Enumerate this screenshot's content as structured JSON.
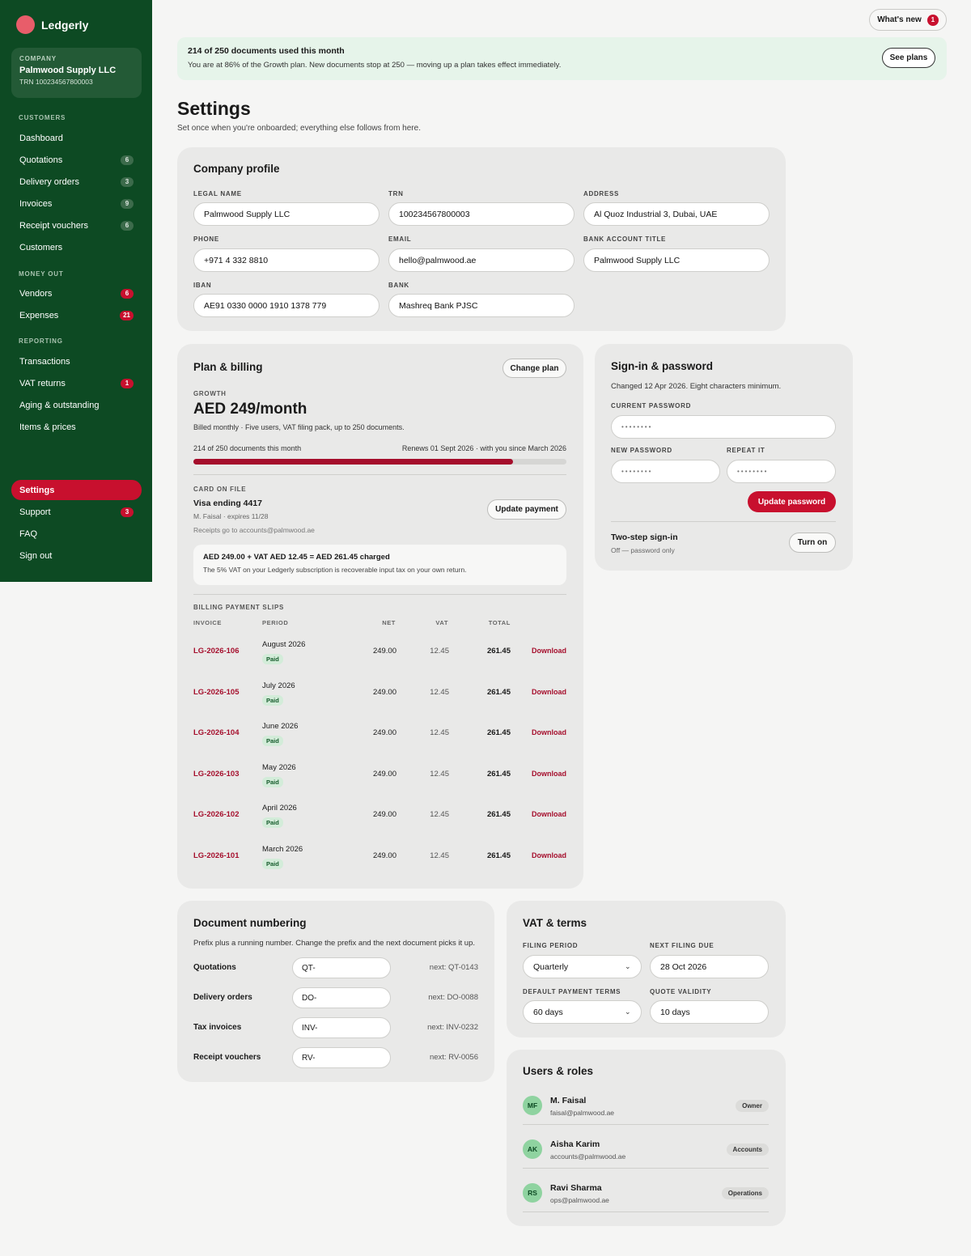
{
  "brand": {
    "name": "Ledgerly"
  },
  "company_card": {
    "label": "COMPANY",
    "name": "Palmwood Supply LLC",
    "trn": "TRN 100234567800003"
  },
  "sidebar": {
    "sections": {
      "customers": "CUSTOMERS",
      "money_out": "MONEY OUT",
      "reporting": "REPORTING"
    },
    "items": [
      {
        "label": "Dashboard",
        "badge": ""
      },
      {
        "label": "Quotations",
        "badge": "6"
      },
      {
        "label": "Delivery orders",
        "badge": "3"
      },
      {
        "label": "Invoices",
        "badge": "9"
      },
      {
        "label": "Receipt vouchers",
        "badge": "6"
      },
      {
        "label": "Customers",
        "badge": ""
      },
      {
        "label": "Vendors",
        "badge": "6"
      },
      {
        "label": "Expenses",
        "badge": "21"
      },
      {
        "label": "Transactions",
        "badge": ""
      },
      {
        "label": "VAT returns",
        "badge": "1"
      },
      {
        "label": "Aging & outstanding",
        "badge": ""
      },
      {
        "label": "Items & prices",
        "badge": ""
      },
      {
        "label": "Settings",
        "badge": ""
      },
      {
        "label": "Support",
        "badge": "3"
      },
      {
        "label": "FAQ",
        "badge": ""
      },
      {
        "label": "Sign out",
        "badge": ""
      }
    ]
  },
  "topbar": {
    "whats_new": "What's new",
    "whats_new_count": "1"
  },
  "banner": {
    "title": "214 of 250 documents used this month",
    "text": "You are at 86% of the Growth plan. New documents stop at 250 — moving up a plan takes effect immediately.",
    "button": "See plans"
  },
  "page": {
    "title": "Settings",
    "subtitle": "Set once when you're onboarded; everything else follows from here."
  },
  "company_profile": {
    "title": "Company profile",
    "fields": {
      "legal_name": {
        "label": "LEGAL NAME",
        "value": "Palmwood Supply LLC"
      },
      "trn": {
        "label": "TRN",
        "value": "100234567800003"
      },
      "address": {
        "label": "ADDRESS",
        "value": "Al Quoz Industrial 3, Dubai, UAE"
      },
      "phone": {
        "label": "PHONE",
        "value": "+971 4 332 8810"
      },
      "email": {
        "label": "EMAIL",
        "value": "hello@palmwood.ae"
      },
      "bank_account_title": {
        "label": "BANK ACCOUNT TITLE",
        "value": "Palmwood Supply LLC"
      },
      "iban": {
        "label": "IBAN",
        "value": "AE91 0330 0000 1910 1378 779"
      },
      "bank": {
        "label": "BANK",
        "value": "Mashreq Bank PJSC"
      }
    }
  },
  "plan": {
    "title": "Plan & billing",
    "change_button": "Change plan",
    "tier": "GROWTH",
    "price": "AED 249/month",
    "description": "Billed monthly · Five users, VAT filing pack, up to 250 documents.",
    "usage_text": "214 of 250 documents this month",
    "renewal_text": "Renews 01 Sept 2026 · with you since March 2026",
    "usage_fraction": 0.856,
    "card_label": "CARD ON FILE",
    "card_name": "Visa ending 4417",
    "card_holder": "M. Faisal · expires 11/28",
    "receipts_to": "Receipts go to accounts@palmwood.ae",
    "update_payment": "Update payment",
    "vat_line": "AED 249.00 + VAT AED 12.45 = AED 261.45 charged",
    "vat_note": "The 5% VAT on your Ledgerly subscription is recoverable input tax on your own return.",
    "slips_label": "BILLING PAYMENT SLIPS",
    "slip_headers": {
      "invoice": "INVOICE",
      "period": "PERIOD",
      "net": "NET",
      "vat": "VAT",
      "total": "TOTAL"
    },
    "slips": [
      {
        "invoice": "LG-2026-106",
        "period": "August 2026",
        "status": "Paid",
        "net": "249.00",
        "vat": "12.45",
        "total": "261.45",
        "action": "Download"
      },
      {
        "invoice": "LG-2026-105",
        "period": "July 2026",
        "status": "Paid",
        "net": "249.00",
        "vat": "12.45",
        "total": "261.45",
        "action": "Download"
      },
      {
        "invoice": "LG-2026-104",
        "period": "June 2026",
        "status": "Paid",
        "net": "249.00",
        "vat": "12.45",
        "total": "261.45",
        "action": "Download"
      },
      {
        "invoice": "LG-2026-103",
        "period": "May 2026",
        "status": "Paid",
        "net": "249.00",
        "vat": "12.45",
        "total": "261.45",
        "action": "Download"
      },
      {
        "invoice": "LG-2026-102",
        "period": "April 2026",
        "status": "Paid",
        "net": "249.00",
        "vat": "12.45",
        "total": "261.45",
        "action": "Download"
      },
      {
        "invoice": "LG-2026-101",
        "period": "March 2026",
        "status": "Paid",
        "net": "249.00",
        "vat": "12.45",
        "total": "261.45",
        "action": "Download"
      }
    ]
  },
  "signin": {
    "title": "Sign-in & password",
    "note": "Changed 12 Apr 2026. Eight characters minimum.",
    "current_label": "CURRENT PASSWORD",
    "new_label": "NEW PASSWORD",
    "repeat_label": "REPEAT IT",
    "masked": "••••••••",
    "update_button": "Update password",
    "two_step_title": "Two-step sign-in",
    "two_step_status": "Off — password only",
    "turn_on": "Turn on"
  },
  "numbering": {
    "title": "Document numbering",
    "note": "Prefix plus a running number. Change the prefix and the next document picks it up.",
    "rows": [
      {
        "label": "Quotations",
        "prefix": "QT-",
        "next": "next: QT-0143"
      },
      {
        "label": "Delivery orders",
        "prefix": "DO-",
        "next": "next: DO-0088"
      },
      {
        "label": "Tax invoices",
        "prefix": "INV-",
        "next": "next: INV-0232"
      },
      {
        "label": "Receipt vouchers",
        "prefix": "RV-",
        "next": "next: RV-0056"
      }
    ]
  },
  "vat_terms": {
    "title": "VAT & terms",
    "filing_period_label": "FILING PERIOD",
    "filing_period": "Quarterly",
    "next_filing_label": "NEXT FILING DUE",
    "next_filing": "28 Oct 2026",
    "payment_terms_label": "DEFAULT PAYMENT TERMS",
    "payment_terms": "60 days",
    "quote_validity_label": "QUOTE VALIDITY",
    "quote_validity": "10 days"
  },
  "users": {
    "title": "Users & roles",
    "list": [
      {
        "initials": "MF",
        "name": "M. Faisal",
        "email": "faisal@palmwood.ae",
        "role": "Owner"
      },
      {
        "initials": "AK",
        "name": "Aisha Karim",
        "email": "accounts@palmwood.ae",
        "role": "Accounts"
      },
      {
        "initials": "RS",
        "name": "Ravi Sharma",
        "email": "ops@palmwood.ae",
        "role": "Operations"
      }
    ]
  },
  "colors": {
    "sidebar": "#0d4a23",
    "accent": "#c8102e",
    "banner": "#e6f4ea"
  }
}
